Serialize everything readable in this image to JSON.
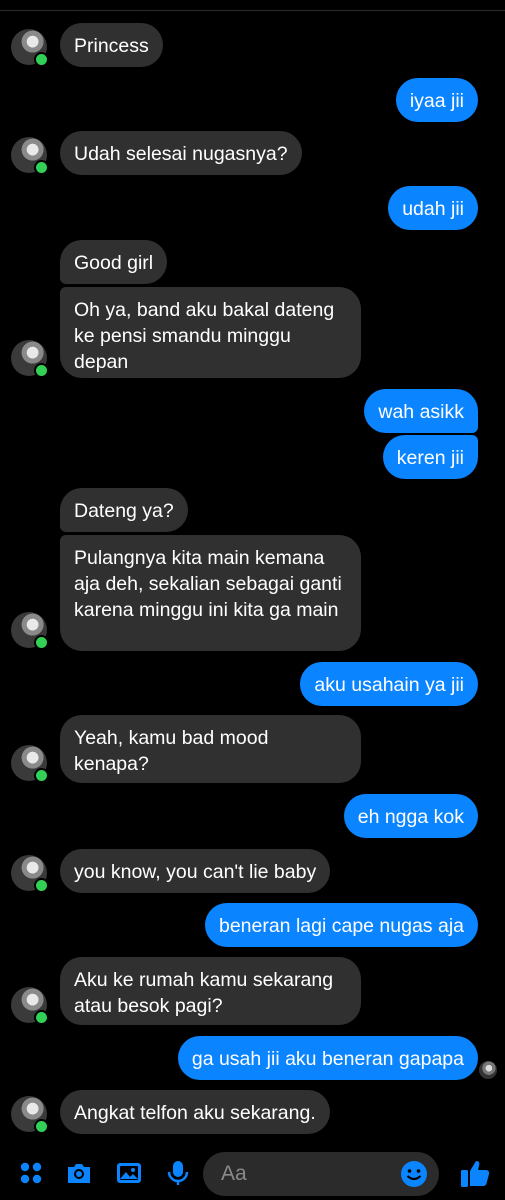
{
  "conversation": {
    "messages": [
      {
        "from": "them",
        "text": "Princess"
      },
      {
        "from": "me",
        "text": "iyaa jii"
      },
      {
        "from": "them",
        "text": "Udah selesai nugasnya?"
      },
      {
        "from": "me",
        "text": "udah jii"
      },
      {
        "from": "them",
        "text": "Good girl"
      },
      {
        "from": "them",
        "text": "Oh ya, band aku bakal dateng ke pensi smandu minggu depan"
      },
      {
        "from": "me",
        "text": "wah asikk"
      },
      {
        "from": "me",
        "text": "keren jii"
      },
      {
        "from": "them",
        "text": "Dateng ya?"
      },
      {
        "from": "them",
        "text": "Pulangnya kita main kemana aja deh, sekalian sebagai ganti karena minggu ini kita ga main"
      },
      {
        "from": "me",
        "text": "aku usahain ya jii"
      },
      {
        "from": "them",
        "text": "Yeah, kamu bad mood kenapa?"
      },
      {
        "from": "me",
        "text": "eh ngga kok"
      },
      {
        "from": "them",
        "text": "you know, you can't lie baby"
      },
      {
        "from": "me",
        "text": "beneran lagi cape nugas aja"
      },
      {
        "from": "them",
        "text": "Aku ke rumah kamu sekarang atau besok pagi?"
      },
      {
        "from": "me",
        "text": "ga usah jii aku beneran gapapa"
      },
      {
        "from": "them",
        "text": "Angkat telfon aku sekarang."
      }
    ]
  },
  "composer": {
    "placeholder": "Aa",
    "icons": [
      "apps-icon",
      "camera-icon",
      "gallery-icon",
      "mic-icon",
      "emoji-icon",
      "like-icon"
    ]
  },
  "colors": {
    "background": "#000000",
    "incoming_bubble": "#303030",
    "outgoing_bubble": "#0a84ff",
    "accent": "#0a84ff",
    "online": "#31d158"
  }
}
